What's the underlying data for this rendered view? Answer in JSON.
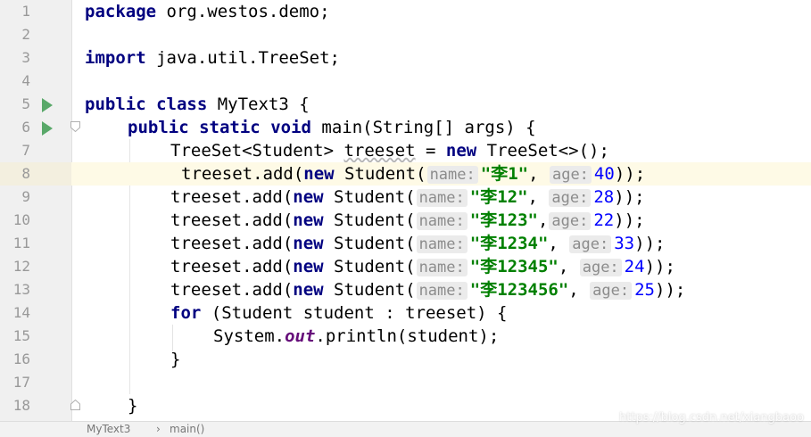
{
  "editor": {
    "lines": [
      {
        "n": "1",
        "p": [
          "package",
          " org.westos.demo;"
        ]
      },
      {
        "n": "2"
      },
      {
        "n": "3",
        "p": [
          "import",
          " java.util.TreeSet;"
        ]
      },
      {
        "n": "4"
      },
      {
        "n": "5",
        "p": [
          "public",
          " ",
          "class",
          " MyText3 {"
        ]
      },
      {
        "n": "6",
        "p": [
          "public",
          " ",
          "static",
          " ",
          "void",
          " main(String[] args) {"
        ]
      },
      {
        "n": "7",
        "p": [
          "TreeSet<Student> ",
          "treeset",
          " = ",
          "new",
          " TreeSet<>();"
        ]
      },
      {
        "n": "8",
        "p": [
          "treeset.add(",
          "new",
          " Student(",
          "name:",
          "\"李1\"",
          ", ",
          "age:",
          "40",
          "));"
        ]
      },
      {
        "n": "9",
        "p": [
          "treeset.add(",
          "new",
          " Student(",
          "name:",
          "\"李12\"",
          ", ",
          "age:",
          "28",
          "));"
        ]
      },
      {
        "n": "10",
        "p": [
          "treeset.add(",
          "new",
          " Student(",
          "name:",
          "\"李123\"",
          ",",
          "age:",
          "22",
          "));"
        ]
      },
      {
        "n": "11",
        "p": [
          "treeset.add(",
          "new",
          " Student(",
          "name:",
          "\"李1234\"",
          ", ",
          "age:",
          "33",
          "));"
        ]
      },
      {
        "n": "12",
        "p": [
          "treeset.add(",
          "new",
          " Student(",
          "name:",
          "\"李12345\"",
          ", ",
          "age:",
          "24",
          "));"
        ]
      },
      {
        "n": "13",
        "p": [
          "treeset.add(",
          "new",
          " Student(",
          "name:",
          "\"李123456\"",
          ", ",
          "age:",
          "25",
          "));"
        ]
      },
      {
        "n": "14",
        "p": [
          "for",
          " (Student student : treeset) {"
        ]
      },
      {
        "n": "15",
        "p": [
          "System.",
          "out",
          ".println(student);"
        ]
      },
      {
        "n": "16",
        "p": [
          "}"
        ]
      },
      {
        "n": "17"
      },
      {
        "n": "18",
        "p": [
          "}"
        ]
      }
    ]
  },
  "breadcrumb": {
    "items": [
      "MyText3",
      "main()"
    ],
    "separator": "›"
  },
  "watermark": "https://blog.csdn.net/xiangbaoo",
  "colors": {
    "keyword": "#000080",
    "string": "#008000",
    "number": "#0000ff",
    "run_icon": "#59a869",
    "current_line": "#fefae6"
  }
}
